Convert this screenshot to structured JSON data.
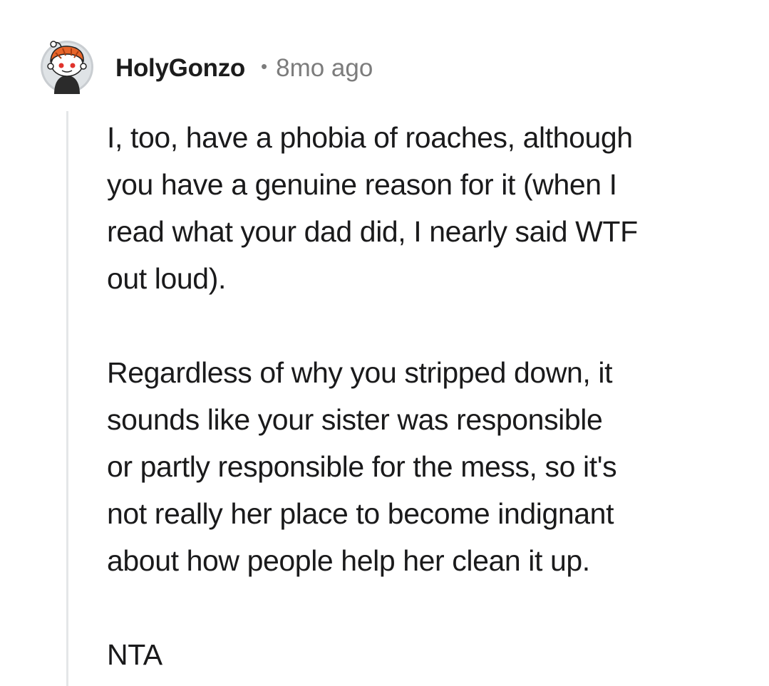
{
  "comment": {
    "username": "HolyGonzo",
    "separator": "•",
    "timestamp": "8mo ago",
    "avatar_icon": "reddit-snoo-avatar-icon",
    "paragraphs": [
      {
        "lines": [
          "I, too, have a phobia of roaches, although",
          "you have a genuine reason for it (when I",
          "read what your dad did, I nearly said WTF",
          "out loud)."
        ]
      },
      {
        "lines": [
          "Regardless of why you stripped down, it",
          "sounds like your sister was responsible",
          "or partly responsible for the mess, so it's",
          "not really her place to become indignant",
          "about how people help her clean it up."
        ]
      },
      {
        "lines": [
          "NTA"
        ]
      }
    ]
  }
}
